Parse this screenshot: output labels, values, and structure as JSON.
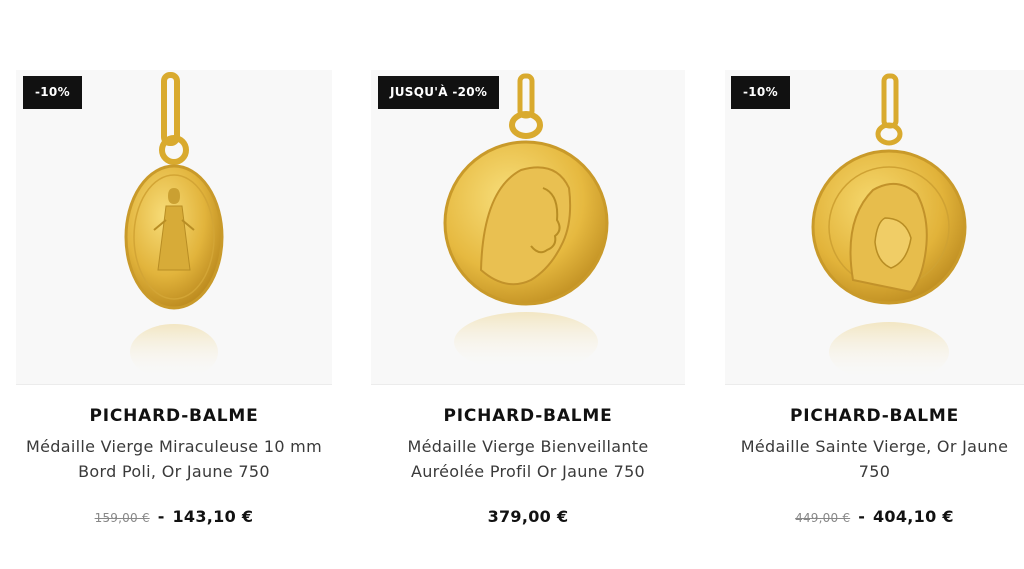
{
  "products": [
    {
      "badge": "-10%",
      "brand": "PICHARD-BALME",
      "title": "Médaille Vierge Miraculeuse 10 mm Bord Poli, Or Jaune 750",
      "old_price": "159,00 €",
      "separator": "-",
      "price": "143,10 €",
      "icon": "oval-miraculous-medal"
    },
    {
      "badge": "JUSQU'À -20%",
      "brand": "PICHARD-BALME",
      "title": "Médaille Vierge Bienveillante Auréolée Profil Or Jaune 750",
      "price": "379,00 €",
      "icon": "round-virgin-profile-medal"
    },
    {
      "badge": "-10%",
      "brand": "PICHARD-BALME",
      "title": "Médaille Sainte Vierge, Or Jaune 750",
      "old_price": "449,00 €",
      "separator": "-",
      "price": "404,10 €",
      "icon": "round-holy-virgin-medal"
    }
  ],
  "colors": {
    "gold_light": "#f3d36a",
    "gold_mid": "#e0b23a",
    "gold_dark": "#b8861c",
    "badge_bg": "#111111",
    "image_bg": "#f8f8f8"
  }
}
